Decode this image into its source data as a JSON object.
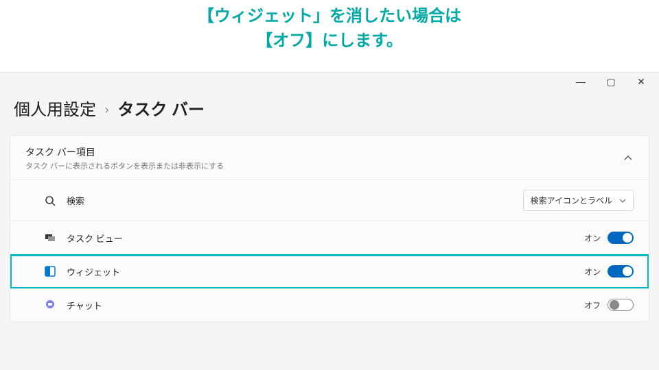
{
  "instruction": {
    "line1": "【ウィジェット」を消したい場合は",
    "line2": "【オフ】にします。"
  },
  "window_controls": {
    "min": "—",
    "max": "▢",
    "close": "✕"
  },
  "breadcrumb": {
    "parent": "個人用設定",
    "sep": "›",
    "current": "タスク バー"
  },
  "panel": {
    "title": "タスク バー項目",
    "subtitle": "タスク バーに表示されるボタンを表示または非表示にする"
  },
  "rows": {
    "search": {
      "label": "検索",
      "dropdown": "検索アイコンとラベル"
    },
    "taskview": {
      "label": "タスク ビュー",
      "state": "オン",
      "on": true
    },
    "widgets": {
      "label": "ウィジェット",
      "state": "オン",
      "on": true
    },
    "chat": {
      "label": "チャット",
      "state": "オフ",
      "on": false
    }
  }
}
